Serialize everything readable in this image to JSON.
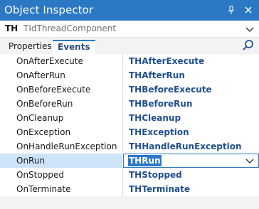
{
  "window": {
    "title": "Object Inspector",
    "pin_icon": "pin-icon",
    "close_icon": "close-icon",
    "accent": "#2b78c5"
  },
  "component": {
    "name": "TH",
    "type": "TIdThreadComponent"
  },
  "tabs": [
    {
      "label": "Properties"
    },
    {
      "label": "Events"
    }
  ],
  "events": [
    {
      "name": "OnAfterExecute",
      "value": "THAfterExecute"
    },
    {
      "name": "OnAfterRun",
      "value": "THAfterRun"
    },
    {
      "name": "OnBeforeExecute",
      "value": "THBeforeExecute"
    },
    {
      "name": "OnBeforeRun",
      "value": "THBeforeRun"
    },
    {
      "name": "OnCleanup",
      "value": "THCleanup"
    },
    {
      "name": "OnException",
      "value": "THException"
    },
    {
      "name": "OnHandleRunException",
      "value": "THHandleRunException"
    },
    {
      "name": "OnRun",
      "value": "THRun"
    },
    {
      "name": "OnStopped",
      "value": "THStopped"
    },
    {
      "name": "OnTerminate",
      "value": "THTerminate"
    }
  ]
}
